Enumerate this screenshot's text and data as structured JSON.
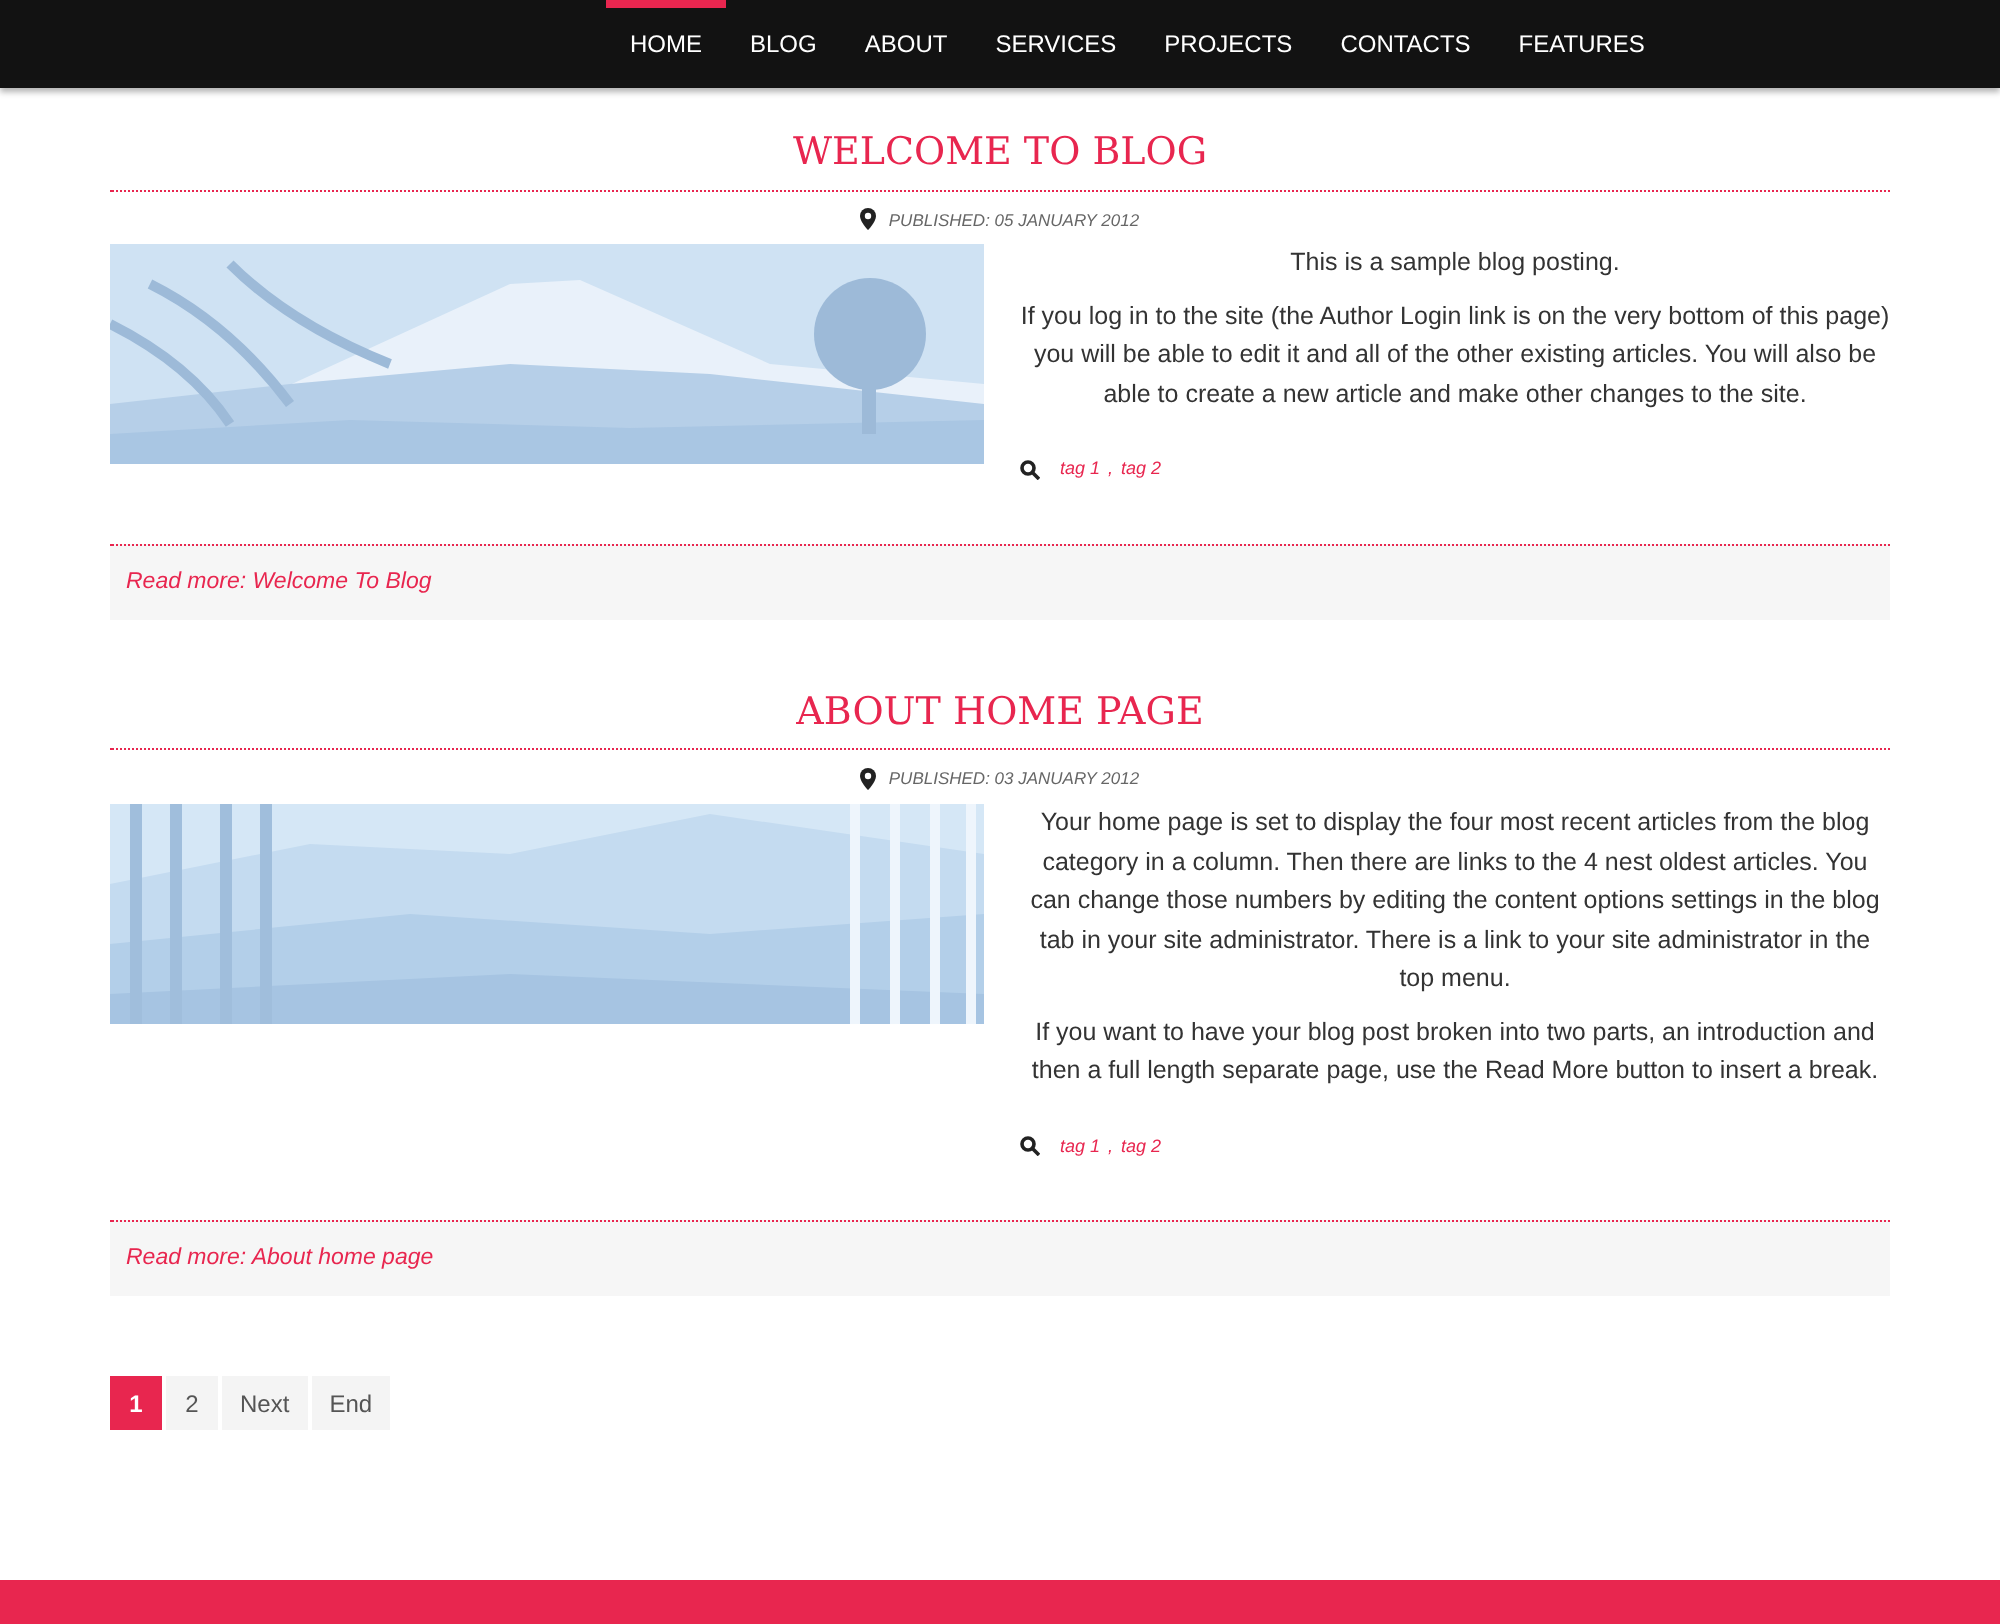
{
  "nav": [
    {
      "label": "HOME",
      "selected": true
    },
    {
      "label": "BLOG",
      "selected": false
    },
    {
      "label": "ABOUT",
      "selected": false
    },
    {
      "label": "SERVICES",
      "selected": false
    },
    {
      "label": "PROJECTS",
      "selected": false
    },
    {
      "label": "CONTACTS",
      "selected": false
    },
    {
      "label": "FEATURES",
      "selected": false
    }
  ],
  "articles": [
    {
      "title": "WELCOME TO BLOG",
      "published": "PUBLISHED: 05 JANUARY 2012",
      "kind": "mountain",
      "paragraphs": [
        "This is a sample blog posting.",
        "If you log in to the site (the Author Login link is on the very bottom of this page) you will be able to edit it and all of the other existing articles. You will also be able to create a new article and make other changes to the site."
      ],
      "tags": [
        "tag 1",
        "tag 2"
      ],
      "tag_separator": ",",
      "read_more": "Read more: Welcome To Blog"
    },
    {
      "title": "ABOUT HOME PAGE",
      "published": "PUBLISHED: 03 JANUARY 2012",
      "kind": "bamboo",
      "paragraphs": [
        "Your home page is set to display the four most recent articles from the blog category in a column. Then there are links to the 4 nest oldest articles. You can change those numbers by editing the content options settings in the blog tab in your site administrator. There is a link to your site administrator in the top menu.",
        "If you want to have your blog post broken into two parts, an introduction and then a full length separate page, use the Read More button to insert a break."
      ],
      "tags": [
        "tag 1",
        "tag 2"
      ],
      "tag_separator": ",",
      "read_more": "Read more: About home page"
    }
  ],
  "pagination": [
    {
      "label": "1",
      "selected": true
    },
    {
      "label": "2",
      "selected": false
    },
    {
      "label": "Next",
      "selected": false
    },
    {
      "label": "End",
      "selected": false
    }
  ]
}
